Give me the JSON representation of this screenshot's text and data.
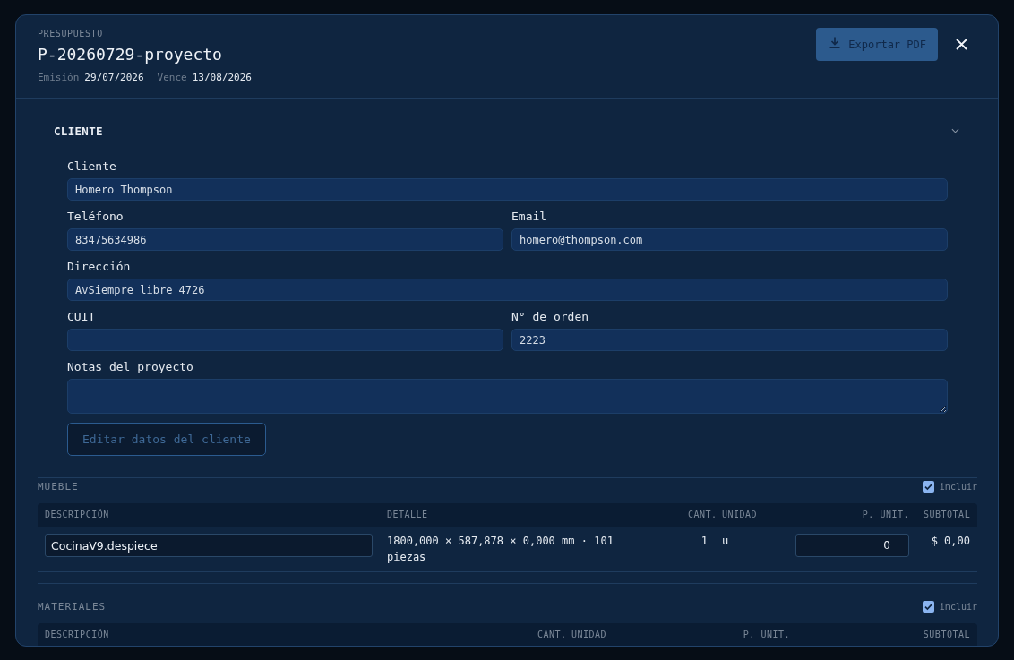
{
  "header": {
    "eyebrow": "PRESUPUESTO",
    "title": "P-20260729-proyecto",
    "dates": [
      {
        "label": "Emisión",
        "value": "29/07/2026"
      },
      {
        "label": "Vence",
        "value": "13/08/2026"
      }
    ],
    "export_button": "Exportar PDF"
  },
  "client_section": {
    "title": "CLIENTE",
    "expanded": true,
    "rows": [
      [
        {
          "label": "Cliente",
          "value": "Homero Thompson",
          "kind": "input"
        }
      ],
      [
        {
          "label": "Teléfono",
          "value": "83475634986",
          "kind": "input"
        },
        {
          "label": "Email",
          "value": "homero@thompson.com",
          "kind": "input"
        }
      ],
      [
        {
          "label": "Dirección",
          "value": "AvSiempre libre 4726",
          "kind": "input"
        }
      ],
      [
        {
          "label": "CUIT",
          "kind": "input"
        },
        {
          "label": "N° de orden",
          "value": "2223",
          "kind": "input"
        }
      ],
      [
        {
          "label": "Notas del proyecto",
          "kind": "textarea"
        }
      ]
    ],
    "edit_button": "Editar datos del cliente"
  },
  "sections": [
    {
      "title": "MUEBLE",
      "included": true,
      "include_label": "incluir",
      "columns": [
        {
          "label": "DESCRIPCIÓN",
          "kind": "description"
        },
        {
          "label": "DETALLE",
          "kind": "detail"
        },
        {
          "label": "CANT.",
          "kind": "quantity"
        },
        {
          "label": "UNIDAD",
          "kind": "unit"
        },
        {
          "label": "P. UNIT.",
          "kind": "price"
        },
        {
          "label": "SUBTOTAL",
          "kind": "subtotal"
        }
      ],
      "rows": [
        {
          "description": "CocinaV9.despiece",
          "detail": "1800,000 × 587,878 × 0,000 mm · 101 piezas",
          "quantity": "1",
          "unit": "u",
          "price": "0",
          "subtotal": "$ 0,00"
        }
      ]
    },
    {
      "title": "MATERIALES",
      "included": true,
      "include_label": "incluir",
      "columns": [
        {
          "label": "DESCRIPCIÓN",
          "kind": "description"
        },
        {
          "label": "CANT.",
          "kind": "quantity"
        },
        {
          "label": "UNIDAD",
          "kind": "unit"
        },
        {
          "label": "P. UNIT.",
          "kind": "price"
        },
        {
          "label": "SUBTOTAL",
          "kind": "subtotal"
        }
      ]
    }
  ]
}
